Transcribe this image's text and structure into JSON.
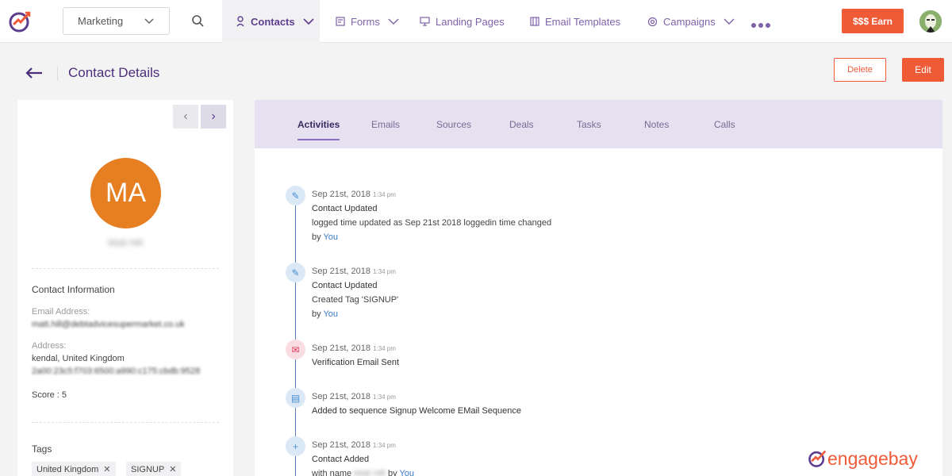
{
  "nav": {
    "workspace": "Marketing",
    "items": [
      {
        "label": "Contacts"
      },
      {
        "label": "Forms"
      },
      {
        "label": "Landing Pages"
      },
      {
        "label": "Email Templates"
      },
      {
        "label": "Campaigns"
      }
    ],
    "earn_label": "$$$ Earn"
  },
  "header": {
    "title": "Contact Details",
    "delete_label": "Delete",
    "edit_label": "Edit"
  },
  "contact": {
    "initials": "MA",
    "name": "Matt Hill",
    "info_title": "Contact Information",
    "email_label": "Email Address:",
    "email": "matt.hill@debtadvicesupermarket.co.uk",
    "address_label": "Address:",
    "address_line1": "kendal, United Kingdom",
    "address_line2": "2a00:23c5:f703:6500:a990:c175:cbdb:9528",
    "score": "Score : 5",
    "tags_title": "Tags",
    "tags": [
      {
        "label": "United Kingdom"
      },
      {
        "label": "SIGNUP"
      }
    ]
  },
  "tabs": [
    {
      "label": "Activities"
    },
    {
      "label": "Emails"
    },
    {
      "label": "Sources"
    },
    {
      "label": "Deals"
    },
    {
      "label": "Tasks"
    },
    {
      "label": "Notes"
    },
    {
      "label": "Calls"
    }
  ],
  "activities": [
    {
      "date": "Sep 21st, 2018",
      "time": "1:34 pm",
      "title": "Contact Updated",
      "line": "logged time updated as Sep 21st 2018 loggedin time changed",
      "by": "by ",
      "you": "You",
      "icon": "pencil-icon"
    },
    {
      "date": "Sep 21st, 2018",
      "time": "1:34 pm",
      "title": "Contact Updated",
      "line": "Created Tag 'SIGNUP'",
      "by": "by ",
      "you": "You",
      "icon": "pencil-icon"
    },
    {
      "date": "Sep 21st, 2018",
      "time": "1:34 pm",
      "title": "Verification Email Sent",
      "icon": "mail-icon"
    },
    {
      "date": "Sep 21st, 2018",
      "time": "1:34 pm",
      "title": "Added to sequence Signup Welcome EMail Sequence",
      "icon": "document-icon"
    },
    {
      "date": "Sep 21st, 2018",
      "time": "1:34 pm",
      "title": "Contact Added",
      "line_prefix": "with name ",
      "line_blur": "Matt Hill",
      "line_suffix": " by ",
      "you": "You",
      "icon": "plus-icon"
    }
  ],
  "brand": {
    "text": "engagebay",
    "accent": "#ef5a37",
    "purple": "#5d3d8e"
  }
}
